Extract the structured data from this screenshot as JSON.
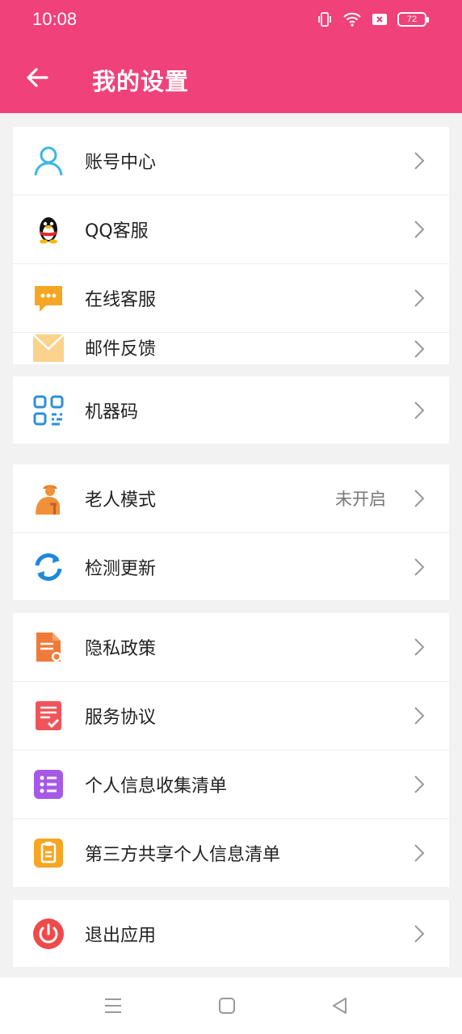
{
  "status": {
    "time": "10:08",
    "battery": "72"
  },
  "header": {
    "title": "我的设置"
  },
  "groups": {
    "g1": [
      {
        "label": "账号中心",
        "icon": "user-icon"
      },
      {
        "label": "QQ客服",
        "icon": "qq-penguin-icon"
      },
      {
        "label": "在线客服",
        "icon": "chat-bubble-icon"
      },
      {
        "label": "邮件反馈",
        "icon": "mail-icon"
      }
    ],
    "g2": [
      {
        "label": "机器码",
        "icon": "qr-code-icon"
      }
    ],
    "g3": [
      {
        "label": "老人模式",
        "value": "未开启",
        "icon": "elder-icon"
      },
      {
        "label": "检测更新",
        "icon": "refresh-icon"
      }
    ],
    "g4": [
      {
        "label": "隐私政策",
        "icon": "privacy-doc-icon"
      },
      {
        "label": "服务协议",
        "icon": "agreement-icon"
      },
      {
        "label": "个人信息收集清单",
        "icon": "list-icon"
      },
      {
        "label": "第三方共享个人信息清单",
        "icon": "clipboard-icon"
      }
    ],
    "g5": [
      {
        "label": "退出应用",
        "icon": "power-icon"
      }
    ]
  },
  "colors": {
    "accent": "#f0417a",
    "background": "#f2f2f2"
  }
}
